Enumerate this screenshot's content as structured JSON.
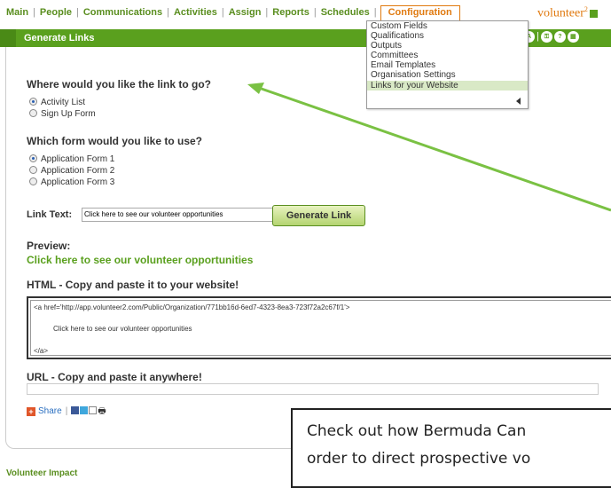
{
  "nav": {
    "items": [
      "Main",
      "People",
      "Communications",
      "Activities",
      "Assign",
      "Reports",
      "Schedules"
    ],
    "active": "Configuration"
  },
  "logo": {
    "text": "volunteer",
    "sup": "2"
  },
  "bar": {
    "title": "Generate Links"
  },
  "dropdown": {
    "items": [
      "Custom Fields",
      "Qualifications",
      "Outputs",
      "Committees",
      "Email Templates",
      "Organisation Settings",
      "Links for your Website"
    ],
    "selected_index": 6
  },
  "q1": {
    "heading": "Where would you like the link to go?",
    "options": [
      "Activity List",
      "Sign Up Form"
    ],
    "selected_index": 0
  },
  "q2": {
    "heading": "Which form would you like to use?",
    "options": [
      "Application Form 1",
      "Application Form 2",
      "Application Form 3"
    ],
    "selected_index": 0
  },
  "link_text": {
    "label": "Link Text:",
    "value": "Click here to see our volunteer opportunities",
    "button": "Generate Link"
  },
  "preview": {
    "heading": "Preview:",
    "link": "Click here to see our volunteer opportunities"
  },
  "html_section": {
    "heading": "HTML - Copy and paste it to your website!",
    "line1": "<a href='http://app.volunteer2.com/Public/Organization/771bb16d-6ed7-4323-8ea3-723f72a2c67f/1'>",
    "line2": "Click here to see our volunteer opportunities",
    "line3": "</a>"
  },
  "url_section": {
    "heading": "URL - Copy and paste it anywhere!",
    "value": ""
  },
  "share": {
    "label": "Share"
  },
  "footer": {
    "text": "Volunteer Impact"
  },
  "callout": {
    "line1": "Check out how Bermuda Can",
    "line2": "order to direct prospective vo"
  },
  "colors": {
    "brand_green": "#5aa01e",
    "accent_orange": "#e07a10",
    "arrow_green": "#7ac143"
  }
}
